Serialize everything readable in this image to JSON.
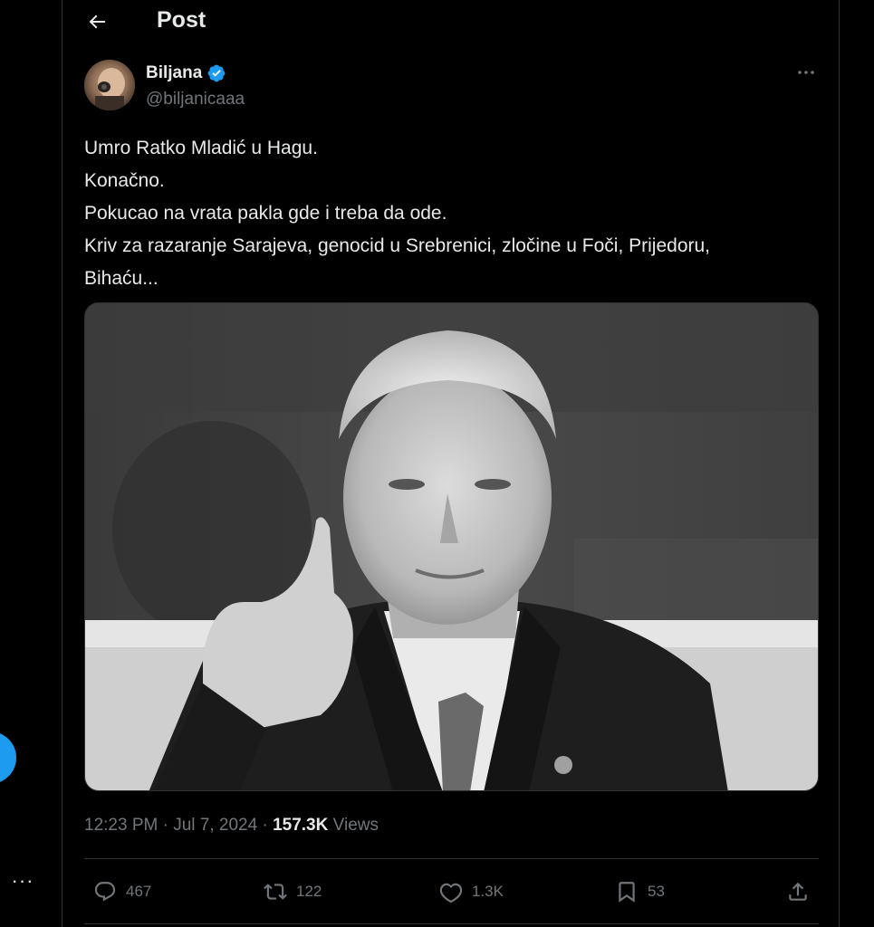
{
  "header": {
    "title": "Post",
    "back_icon": "arrow-left-icon"
  },
  "author": {
    "name": "Biljana",
    "handle": "@biljanicaaa",
    "verified": true,
    "verified_color": "#1d9bf0"
  },
  "tweet": {
    "lines": [
      "Umro Ratko Mladić u Hagu.",
      "Konačno.",
      "Pokucao na vrata pakla gde i treba da ode.",
      "Kriv za razaranje Sarajeva, genocid u Srebrenici, zločine u Foči, Prijedoru,",
      "Bihaću..."
    ],
    "image_icon": "grayscale-portrait-photo"
  },
  "meta": {
    "time": "12:23 PM",
    "separator": "·",
    "date": "Jul 7, 2024",
    "views_count": "157.3K",
    "views_label": "Views"
  },
  "actions": {
    "replies": "467",
    "reposts": "122",
    "likes": "1.3K",
    "bookmarks": "53"
  },
  "colors": {
    "background": "#000000",
    "text": "#e7e9ea",
    "secondary": "#71767b",
    "accent": "#1d9bf0",
    "border": "#2f3336"
  }
}
